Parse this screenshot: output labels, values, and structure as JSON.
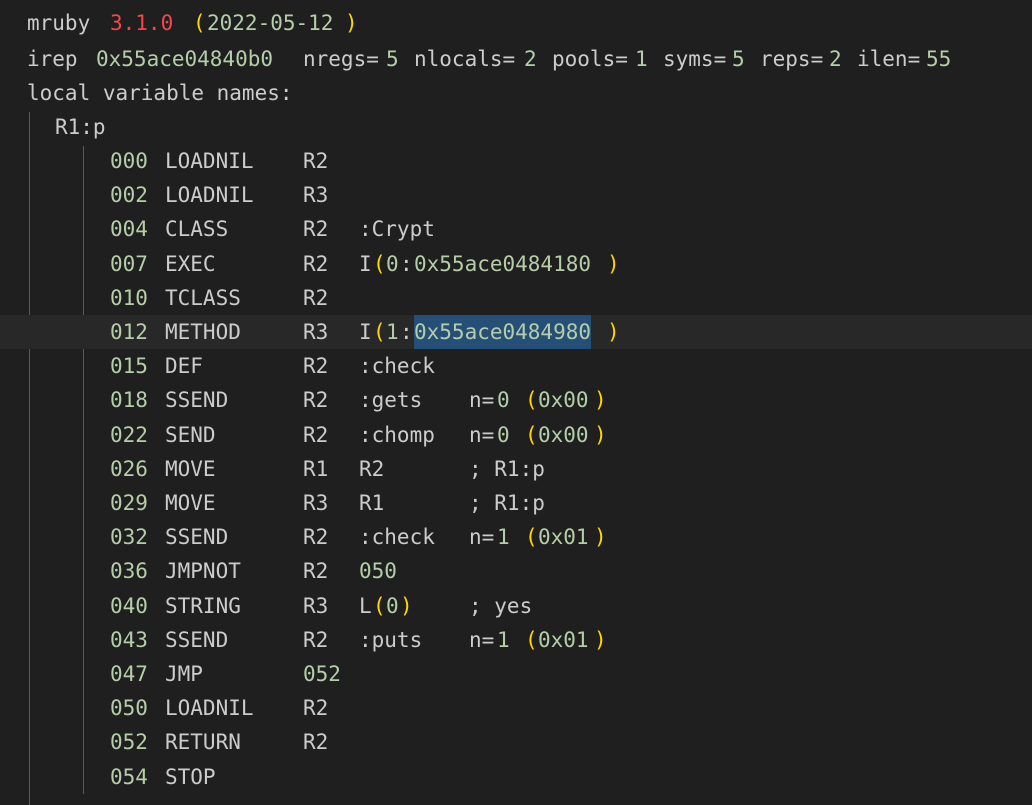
{
  "header": {
    "line1": {
      "name": "mruby",
      "version": "3.1.0",
      "open": "(",
      "date": "2022-05-12",
      "close": ")"
    },
    "line2": {
      "irep_label": "irep",
      "irep_addr": "0x55ace04840b0",
      "nregs_label": "nregs=",
      "nregs": "5",
      "nlocals_label": "nlocals=",
      "nlocals": "2",
      "pools_label": "pools=",
      "pools": "1",
      "syms_label": "syms=",
      "syms": "5",
      "reps_label": "reps=",
      "reps": "2",
      "ilen_label": "ilen=",
      "ilen": "55"
    },
    "line3": "local variable names:",
    "line4": "R1:p"
  },
  "colors": {
    "background": "#1f1f1f",
    "text": "#cccccc",
    "number": "#b5cea8",
    "version_red": "#f44747",
    "bracket_yellow": "#ffd700",
    "selection": "#264f78",
    "current_line": "#282828"
  },
  "instructions": [
    {
      "addr": "000",
      "op": "LOADNIL",
      "reg": "R2"
    },
    {
      "addr": "002",
      "op": "LOADNIL",
      "reg": "R3"
    },
    {
      "addr": "004",
      "op": "CLASS",
      "reg": "R2",
      "arg": ":Crypt"
    },
    {
      "addr": "007",
      "op": "EXEC",
      "reg": "R2",
      "irep": {
        "pre": "I",
        "open": "(",
        "idx": "0",
        "colon": ":",
        "addr": "0x55ace0484180",
        "close": ")"
      }
    },
    {
      "addr": "010",
      "op": "TCLASS",
      "reg": "R2"
    },
    {
      "addr": "012",
      "op": "METHOD",
      "reg": "R3",
      "irep": {
        "pre": "I",
        "open": "(",
        "idx": "1",
        "colon": ":",
        "addr": "0x55ace0484980",
        "close": ")"
      }
    },
    {
      "addr": "015",
      "op": "DEF",
      "reg": "R2",
      "arg": ":check"
    },
    {
      "addr": "018",
      "op": "SSEND",
      "reg": "R2",
      "arg": ":gets",
      "n": {
        "label": "n=",
        "val": "0",
        "open": "(",
        "hex": "0x00",
        "close": ")"
      }
    },
    {
      "addr": "022",
      "op": "SEND",
      "reg": "R2",
      "arg": ":chomp",
      "n": {
        "label": "n=",
        "val": "0",
        "open": "(",
        "hex": "0x00",
        "close": ")"
      }
    },
    {
      "addr": "026",
      "op": "MOVE",
      "reg": "R1",
      "arg": "R2",
      "comment": "; R1:p"
    },
    {
      "addr": "029",
      "op": "MOVE",
      "reg": "R3",
      "arg": "R1",
      "comment": "; R1:p"
    },
    {
      "addr": "032",
      "op": "SSEND",
      "reg": "R2",
      "arg": ":check",
      "n": {
        "label": "n=",
        "val": "1",
        "open": "(",
        "hex": "0x01",
        "close": ")"
      }
    },
    {
      "addr": "036",
      "op": "JMPNOT",
      "reg": "R2",
      "target": "050"
    },
    {
      "addr": "040",
      "op": "STRING",
      "reg": "R3",
      "lit": {
        "pre": "L",
        "open": "(",
        "idx": "0",
        "close": ")"
      },
      "comment": "; yes"
    },
    {
      "addr": "043",
      "op": "SSEND",
      "reg": "R2",
      "arg": ":puts",
      "n": {
        "label": "n=",
        "val": "1",
        "open": "(",
        "hex": "0x01",
        "close": ")"
      }
    },
    {
      "addr": "047",
      "op": "JMP",
      "target_reg": "052"
    },
    {
      "addr": "050",
      "op": "LOADNIL",
      "reg": "R2"
    },
    {
      "addr": "052",
      "op": "RETURN",
      "reg": "R2"
    },
    {
      "addr": "054",
      "op": "STOP"
    }
  ]
}
